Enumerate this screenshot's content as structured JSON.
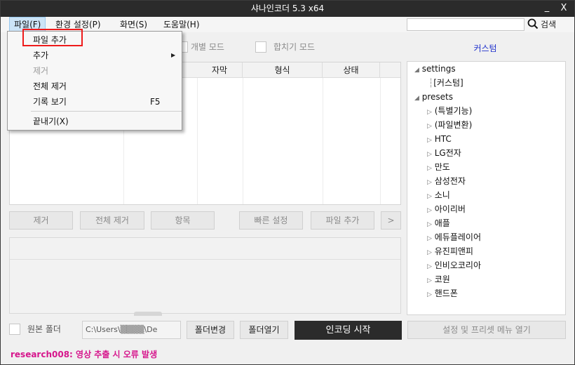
{
  "window": {
    "title": "샤나인코더  5.3  x64",
    "minimize_glyph": "_",
    "close_glyph": "X"
  },
  "menubar": {
    "file": "파일(F)",
    "environment": "환경 설정(P)",
    "view": "화면(S)",
    "help": "도움말(H)"
  },
  "search": {
    "placeholder": "",
    "label": "검색",
    "icon": "search-icon"
  },
  "options": {
    "individual_mode": "개별 모드",
    "merge_mode": "합치기 모드",
    "custom_link": "커스텀"
  },
  "file_table": {
    "columns": [
      "",
      "자막",
      "형식",
      "상태"
    ]
  },
  "buttons": {
    "remove": "제거",
    "remove_all": "전체 제거",
    "items": "항목",
    "quick_settings": "빠른 설정",
    "add_file": "파일 추가",
    "more": ">"
  },
  "tree": {
    "settings": "settings",
    "custom": "[커스텀]",
    "presets": "presets",
    "preset_items": [
      "(특별기능)",
      "(파일변환)",
      "HTC",
      "LG전자",
      "만도",
      "삼성전자",
      "소니",
      "아이리버",
      "애플",
      "에듀플레이어",
      "유진피앤피",
      "인비오코리아",
      "코원",
      "핸드폰"
    ]
  },
  "bottom": {
    "source_folder": "원본 폴더",
    "path": "C:\\Users\\▒▒▒▒\\De",
    "change_folder": "폴더변경",
    "open_folder": "폴더열기",
    "start_encoding": "인코딩 시작",
    "settings_menu": "설정 및 프리셋 메뉴 열기"
  },
  "status": {
    "message": "research008: 영상 추출 시 오류 발생"
  },
  "file_menu": {
    "add_file": "파일 추가",
    "add": "추가",
    "remove": "제거",
    "remove_all": "전체 제거",
    "view_history": "기록 보기",
    "view_history_shortcut": "F5",
    "exit": "끝내기(X)"
  },
  "colors": {
    "titlebar": "#2b2b2b",
    "accent_link": "#2233cc",
    "status_text": "#d6168c",
    "highlight_box": "#ee1b1b"
  }
}
